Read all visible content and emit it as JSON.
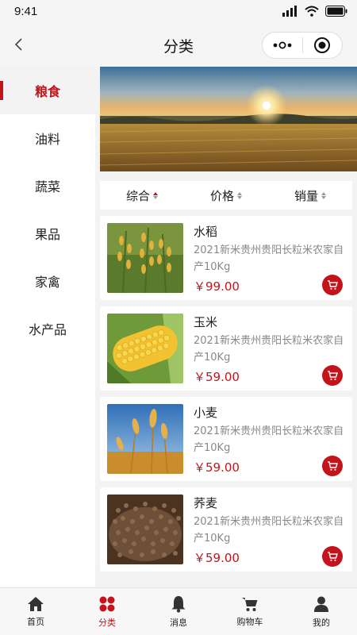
{
  "status_bar": {
    "time": "9:41"
  },
  "nav": {
    "title": "分类"
  },
  "sidebar": {
    "items": [
      {
        "label": "粮食",
        "active": true
      },
      {
        "label": "油料",
        "active": false
      },
      {
        "label": "蔬菜",
        "active": false
      },
      {
        "label": "果品",
        "active": false
      },
      {
        "label": "家禽",
        "active": false
      },
      {
        "label": "水产品",
        "active": false
      }
    ]
  },
  "sort": {
    "items": [
      {
        "label": "综合",
        "active": true
      },
      {
        "label": "价格",
        "active": false
      },
      {
        "label": "销量",
        "active": false
      }
    ]
  },
  "products": [
    {
      "name": "水稻",
      "desc": "2021新米贵州贵阳长粒米农家自产10Kg",
      "price": "￥99.00"
    },
    {
      "name": "玉米",
      "desc": "2021新米贵州贵阳长粒米农家自产10Kg",
      "price": "￥59.00"
    },
    {
      "name": "小麦",
      "desc": "2021新米贵州贵阳长粒米农家自产10Kg",
      "price": "￥59.00"
    },
    {
      "name": "荞麦",
      "desc": "2021新米贵州贵阳长粒米农家自产10Kg",
      "price": "￥59.00"
    }
  ],
  "tabbar": {
    "items": [
      {
        "label": "首页",
        "icon": "home-icon"
      },
      {
        "label": "分类",
        "icon": "category-icon",
        "active": true
      },
      {
        "label": "消息",
        "icon": "bell-icon"
      },
      {
        "label": "购物车",
        "icon": "cart-icon"
      },
      {
        "label": "我的",
        "icon": "user-icon"
      }
    ]
  },
  "colors": {
    "accent": "#c4141b",
    "background": "#f3f3f3"
  }
}
